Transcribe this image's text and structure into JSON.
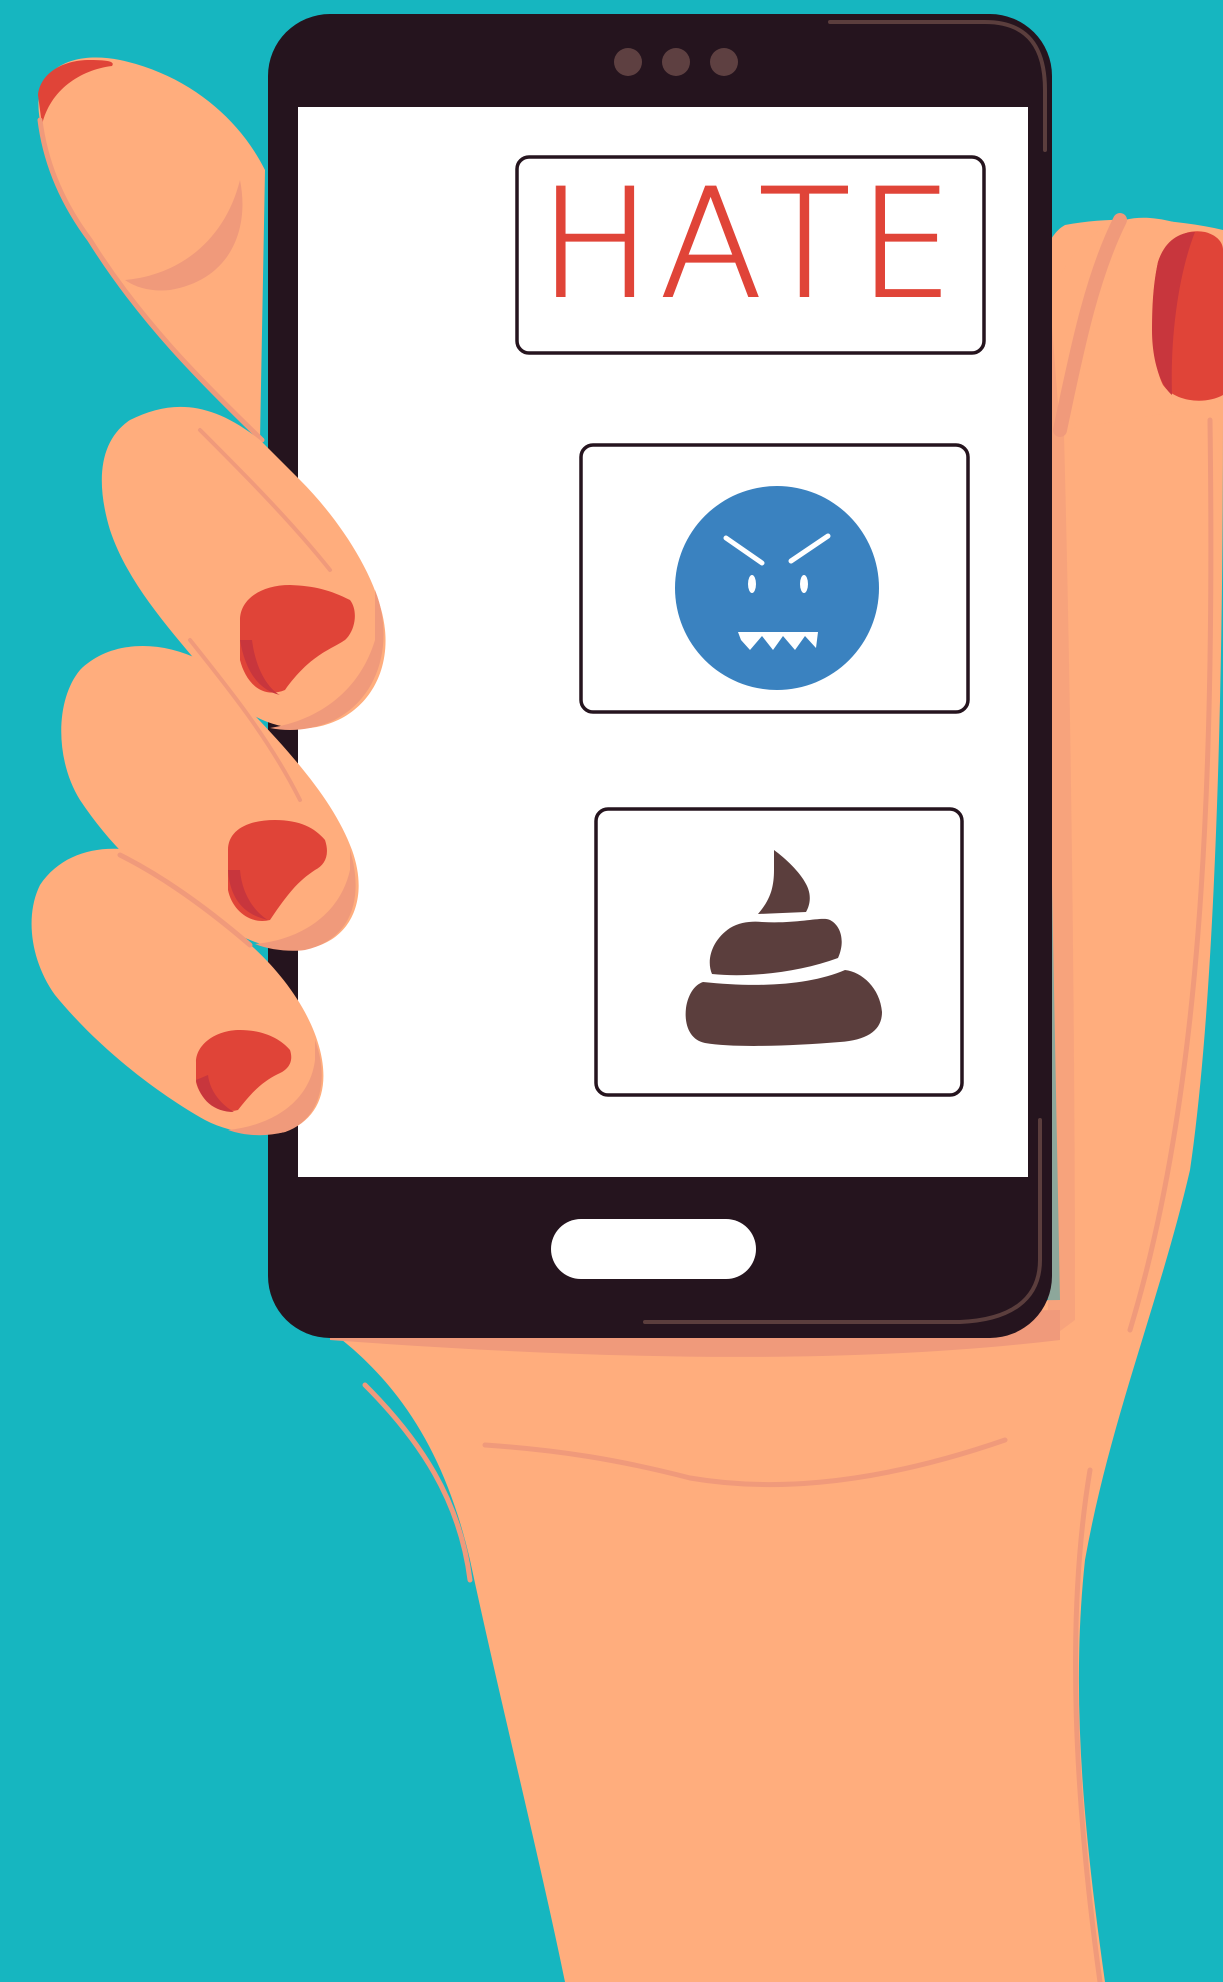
{
  "scene": {
    "background_color": "#16b6c0",
    "skin_color": "#ffad7d",
    "skin_shadow_color": "#f09a7b",
    "nail_color": "#e04438",
    "phone_color": "#25141e",
    "screen_color": "#ffffff"
  },
  "screen": {
    "card_title": {
      "text": "HATE",
      "color": "#e04438"
    },
    "card_angry_face": {
      "icon": "angry-face-icon",
      "face_color": "#3a82c0"
    },
    "card_poop": {
      "icon": "poop-icon",
      "color": "#5b3e3d"
    }
  },
  "phone": {
    "camera_dots": 3,
    "home_button": "home-button"
  }
}
